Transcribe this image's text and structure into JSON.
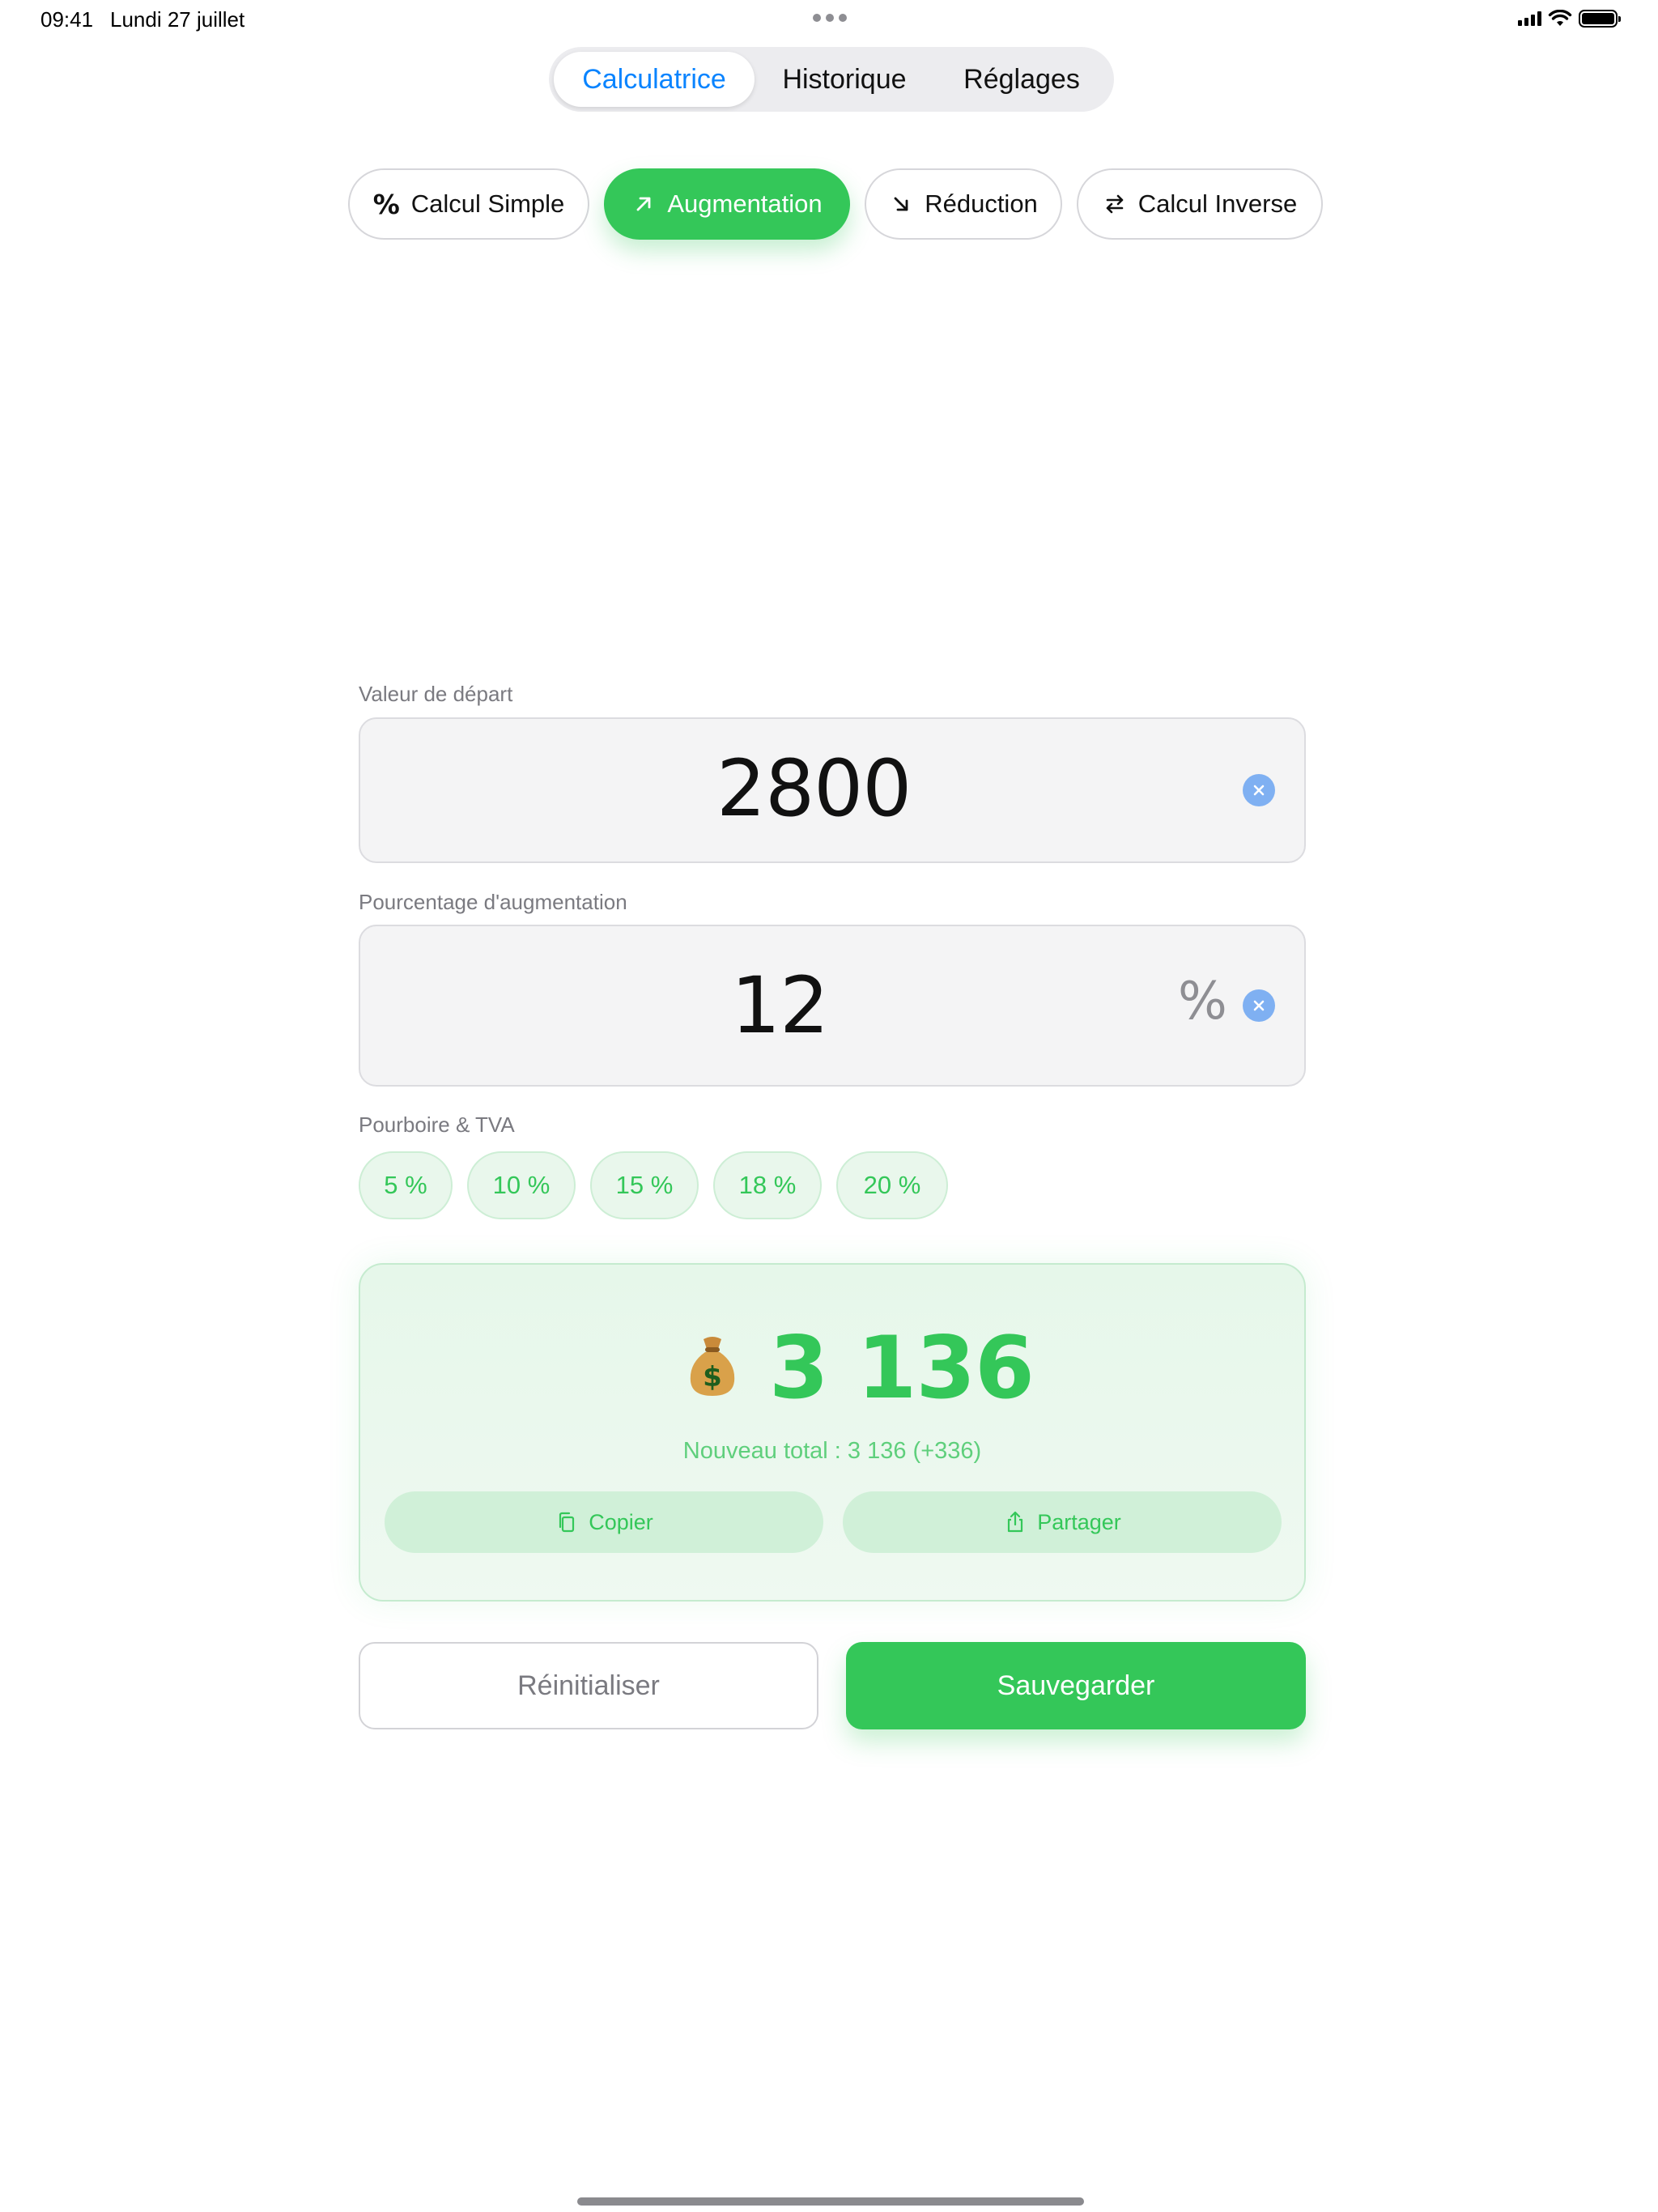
{
  "status_bar": {
    "time": "09:41",
    "date": "Lundi 27 juillet"
  },
  "top_tabs": [
    {
      "label": "Calculatrice",
      "active": true
    },
    {
      "label": "Historique",
      "active": false
    },
    {
      "label": "Réglages",
      "active": false
    }
  ],
  "modes": [
    {
      "label": "Calcul Simple",
      "icon": "percent-icon",
      "active": false
    },
    {
      "label": "Augmentation",
      "icon": "arrow-up-right-icon",
      "active": true
    },
    {
      "label": "Réduction",
      "icon": "arrow-down-right-icon",
      "active": false
    },
    {
      "label": "Calcul Inverse",
      "icon": "swap-arrows-icon",
      "active": false
    }
  ],
  "fields": {
    "start": {
      "label": "Valeur de départ",
      "value": "2800"
    },
    "percent": {
      "label": "Pourcentage d'augmentation",
      "value": "12",
      "unit": "%"
    }
  },
  "presets": {
    "label": "Pourboire & TVA",
    "items": [
      "5 %",
      "10 %",
      "15 %",
      "18 %",
      "20 %"
    ]
  },
  "result": {
    "icon": "money-bag-icon",
    "value": "3 136",
    "caption": "Nouveau total : 3 136 (+336)",
    "copy_label": "Copier",
    "share_label": "Partager"
  },
  "actions": {
    "reset_label": "Réinitialiser",
    "save_label": "Sauvegarder"
  },
  "colors": {
    "accent_green": "#34c759",
    "accent_blue": "#0a84ff"
  }
}
